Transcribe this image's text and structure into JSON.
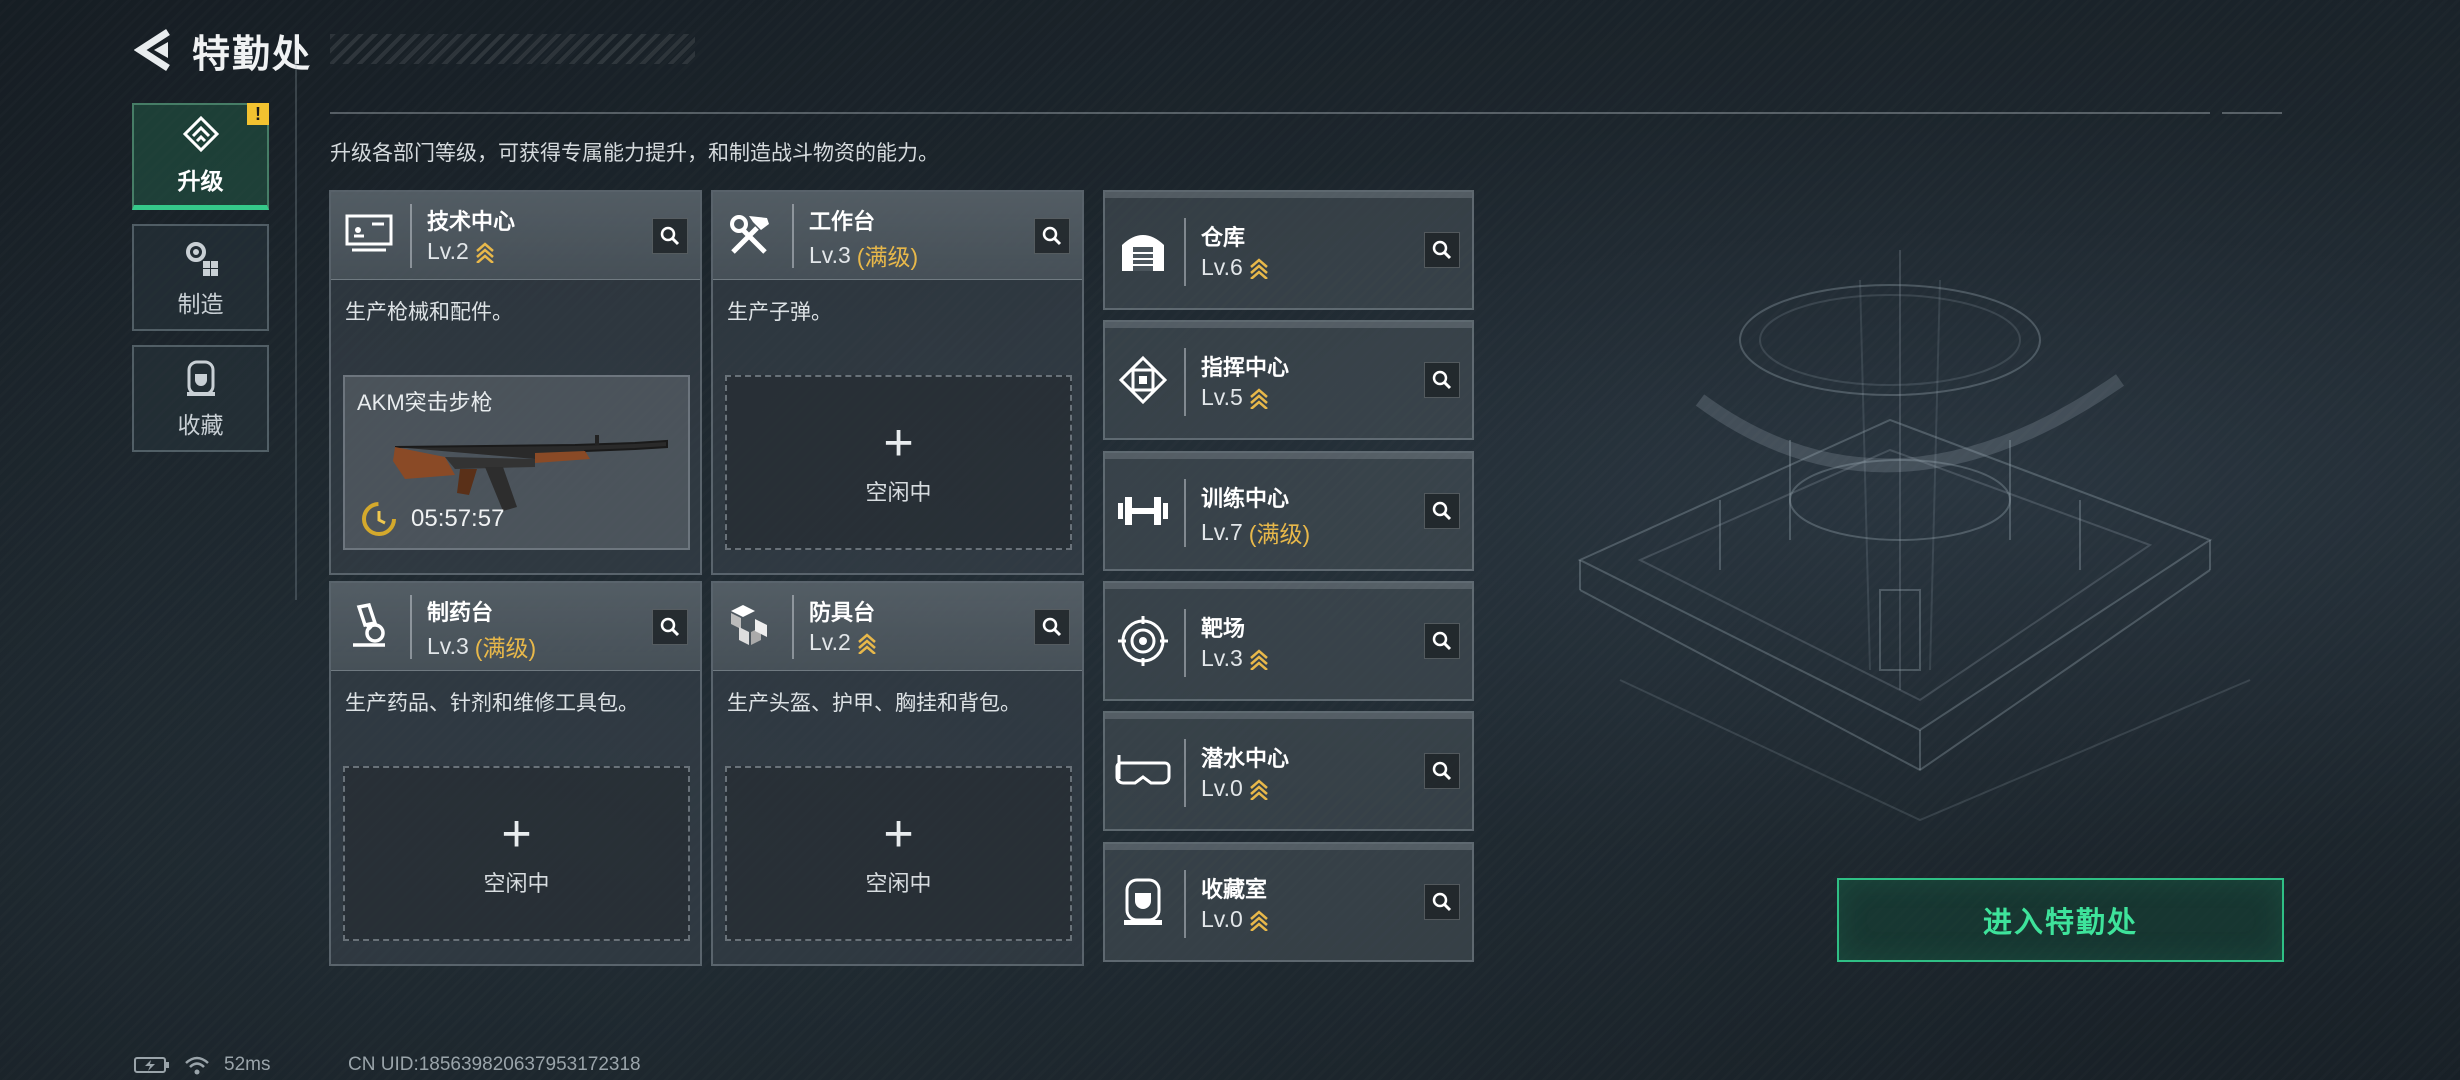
{
  "header": {
    "title": "特勤处"
  },
  "side_tabs": [
    {
      "label": "升级",
      "alert": "!"
    },
    {
      "label": "制造"
    },
    {
      "label": "收藏"
    }
  ],
  "description": "升级各部门等级，可获得专属能力提升，和制造战斗物资的能力。",
  "cards": [
    {
      "name": "技术中心",
      "level": "Lv.2",
      "desc": "生产枪械和配件。",
      "crafting": {
        "item": "AKM突击步枪",
        "timer": "05:57:57"
      }
    },
    {
      "name": "工作台",
      "level": "Lv.3",
      "maxed": "(满级)",
      "desc": "生产子弹。",
      "idle": "空闲中"
    },
    {
      "name": "制药台",
      "level": "Lv.3",
      "maxed": "(满级)",
      "desc": "生产药品、针剂和维修工具包。",
      "idle": "空闲中"
    },
    {
      "name": "防具台",
      "level": "Lv.2",
      "desc": "生产头盔、护甲、胸挂和背包。",
      "idle": "空闲中"
    }
  ],
  "small_cards": [
    {
      "name": "仓库",
      "level": "Lv.6"
    },
    {
      "name": "指挥中心",
      "level": "Lv.5"
    },
    {
      "name": "训练中心",
      "level": "Lv.7",
      "maxed": "(满级)"
    },
    {
      "name": "靶场",
      "level": "Lv.3"
    },
    {
      "name": "潜水中心",
      "level": "Lv.0"
    },
    {
      "name": "收藏室",
      "level": "Lv.0"
    }
  ],
  "idle_plus": "+",
  "enter_button": "进入特勤处",
  "status": {
    "ping": "52ms",
    "uid": "CN UID:1856398206379531723​18"
  },
  "colors": {
    "accent": "#35c98a",
    "maxed": "#e8b84a",
    "alert": "#f2c230"
  }
}
